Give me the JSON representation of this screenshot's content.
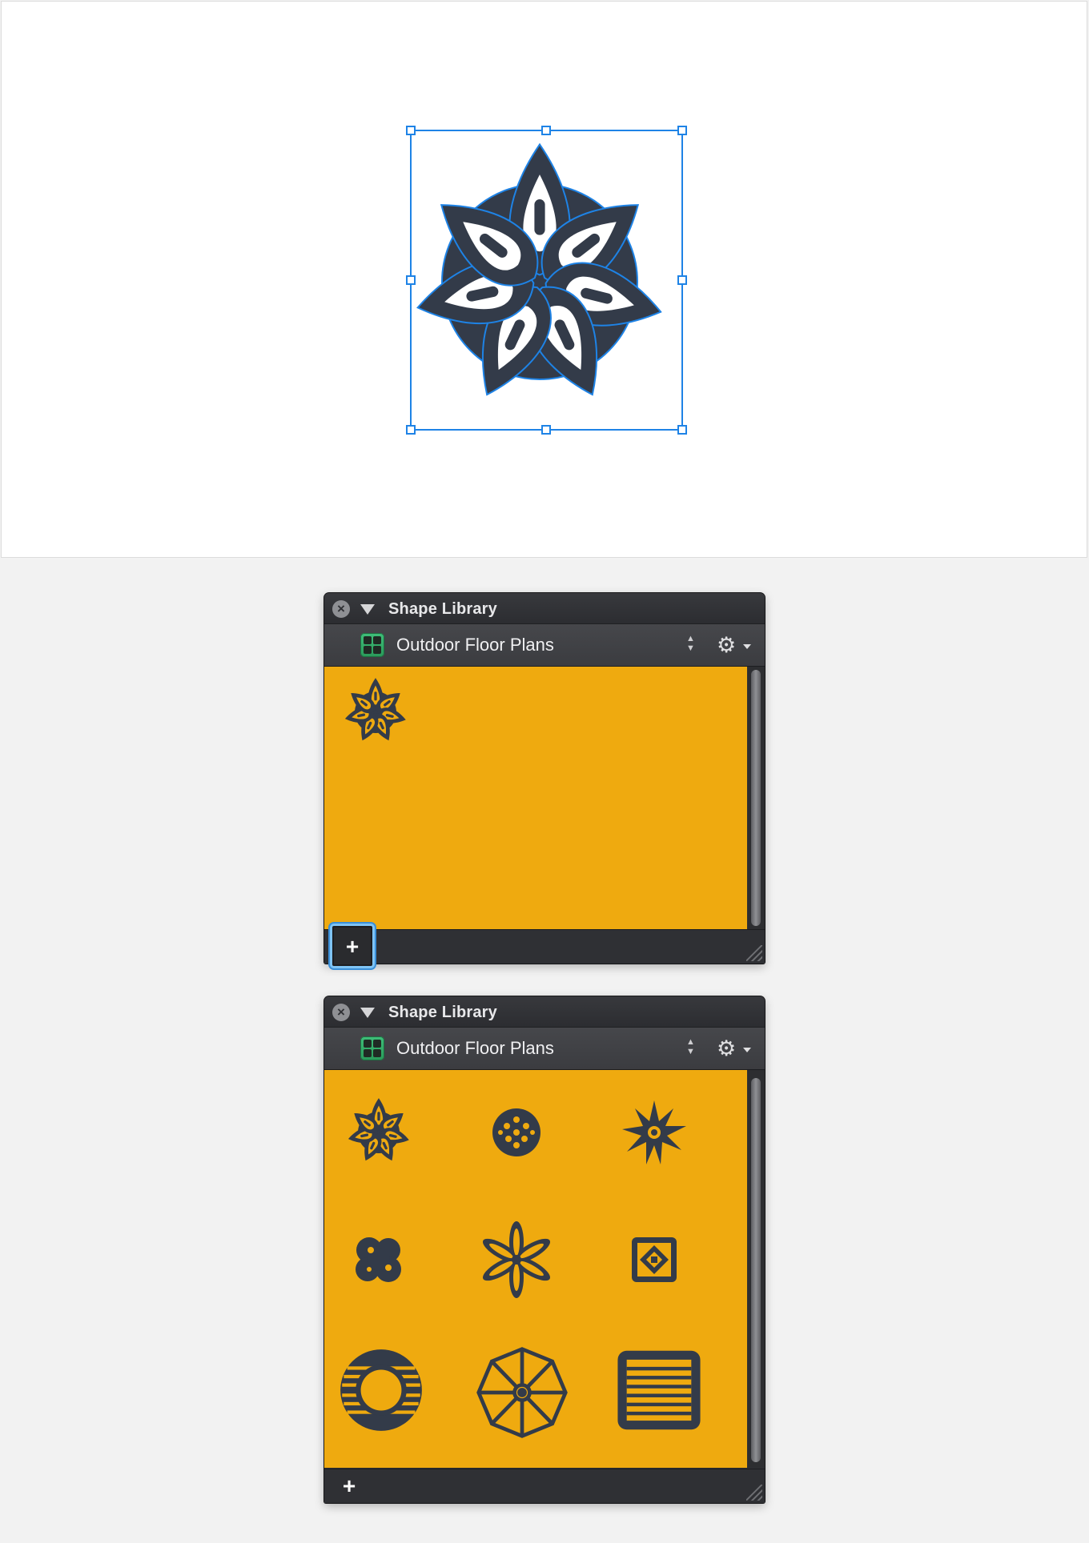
{
  "panels": [
    {
      "title": "Shape Library",
      "library": "Outdoor Floor Plans",
      "add_label": "+",
      "shapes": [
        "star-plant-icon"
      ]
    },
    {
      "title": "Shape Library",
      "library": "Outdoor Floor Plans",
      "add_label": "+",
      "shapes": [
        "star-plant-icon",
        "flower-cluster-icon",
        "spiky-plant-icon",
        "bush-icon",
        "six-petal-flower-icon",
        "tile-square-icon",
        "round-table-icon",
        "umbrella-icon",
        "lounger-icon"
      ]
    }
  ],
  "colors": {
    "shape_fill": "#323a48",
    "library_bg": "#efaa0f",
    "selection": "#1e83e6"
  }
}
